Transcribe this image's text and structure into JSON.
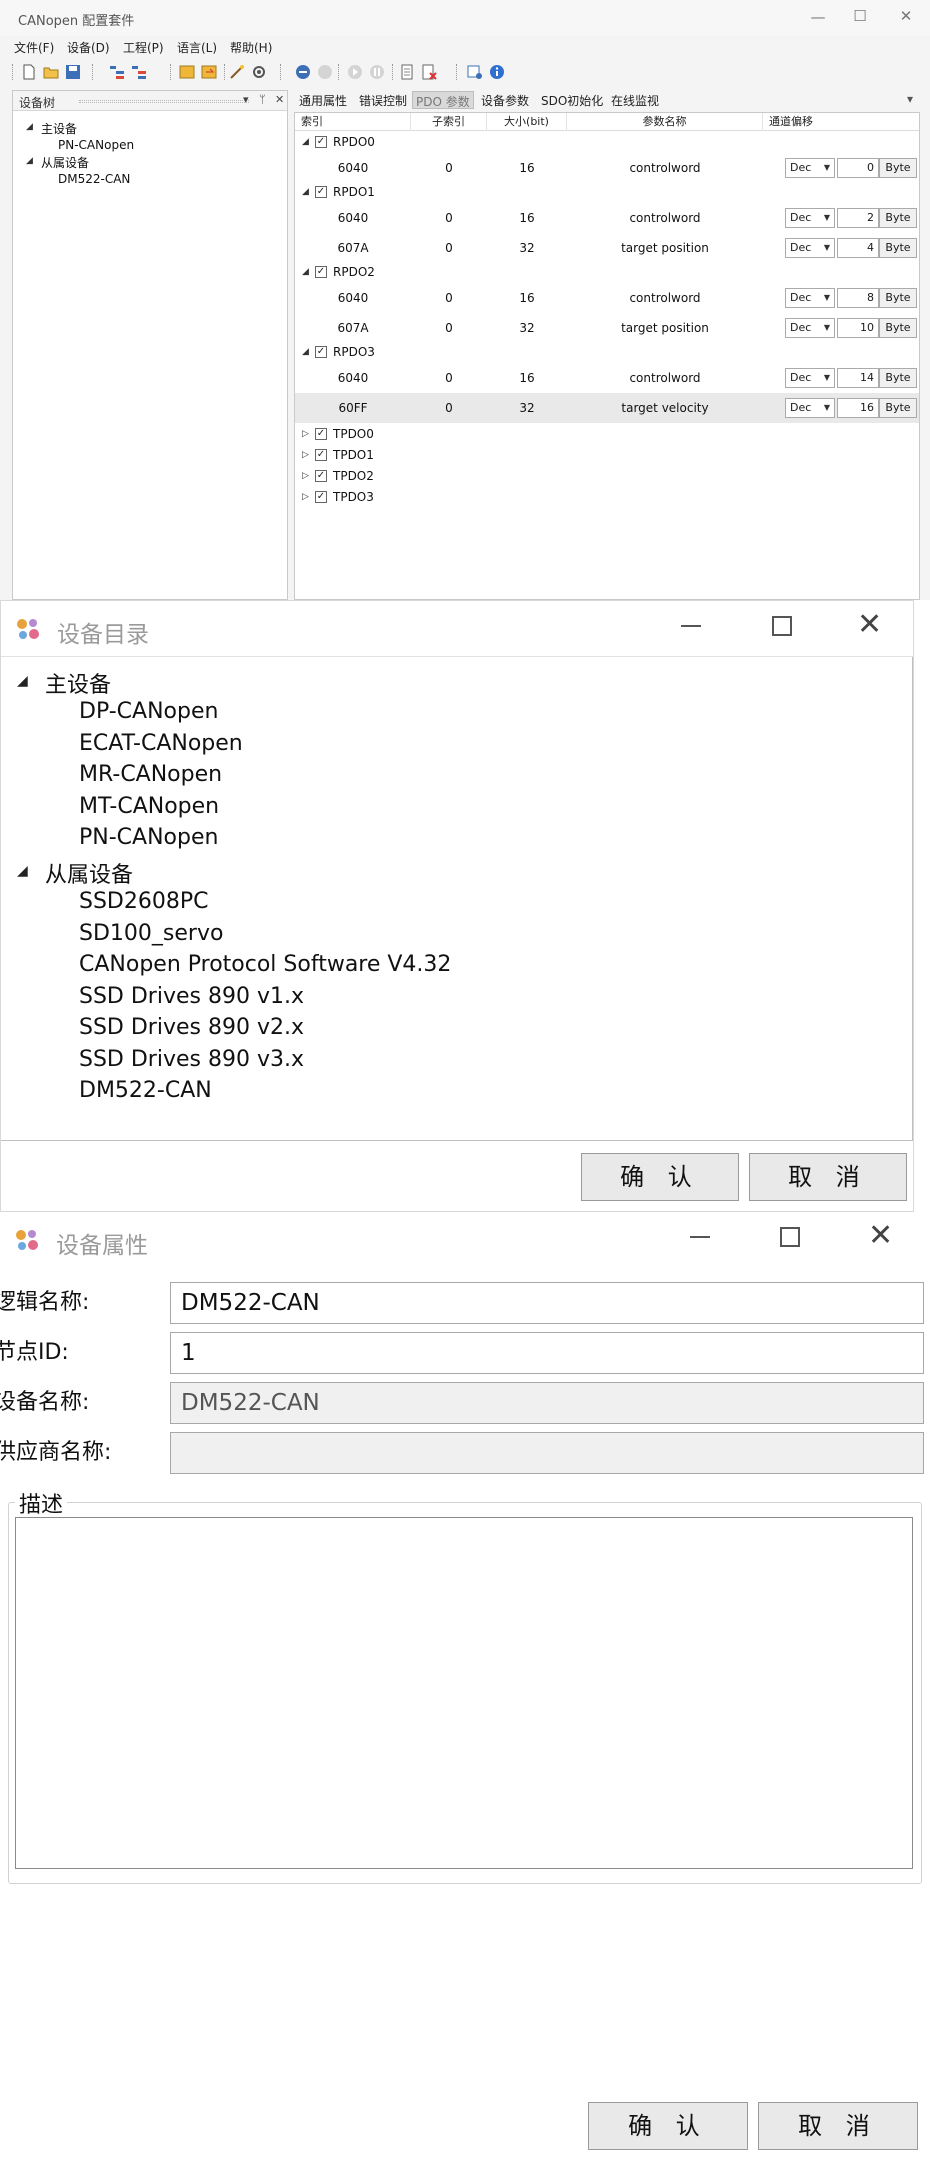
{
  "app": {
    "title": "CANopen 配置套件",
    "menu": [
      "文件(F)",
      "设备(D)",
      "工程(P)",
      "语言(L)",
      "帮助(H)"
    ],
    "tree_panel": {
      "title": "设备树",
      "items": [
        {
          "label": "主设备",
          "level": 0,
          "expanded": true
        },
        {
          "label": "PN-CANopen",
          "level": 1
        },
        {
          "label": "从属设备",
          "level": 0,
          "expanded": true
        },
        {
          "label": "DM522-CAN",
          "level": 1
        }
      ]
    },
    "tabs": [
      "通用属性",
      "错误控制",
      "PDO 参数",
      "设备参数",
      "SDO初始化",
      "在线监视"
    ],
    "active_tab": 2,
    "pdo_table": {
      "columns": [
        "索引",
        "子索引",
        "大小(bit)",
        "参数名称",
        "通道偏移"
      ],
      "rpdo_groups": [
        {
          "name": "RPDO0",
          "rows": [
            {
              "index": "6040",
              "sub": "0",
              "size": "16",
              "param": "controlword",
              "format": "Dec",
              "offset": "0",
              "unit": "Byte"
            }
          ]
        },
        {
          "name": "RPDO1",
          "rows": [
            {
              "index": "6040",
              "sub": "0",
              "size": "16",
              "param": "controlword",
              "format": "Dec",
              "offset": "2",
              "unit": "Byte"
            },
            {
              "index": "607A",
              "sub": "0",
              "size": "32",
              "param": "target position",
              "format": "Dec",
              "offset": "4",
              "unit": "Byte"
            }
          ]
        },
        {
          "name": "RPDO2",
          "rows": [
            {
              "index": "6040",
              "sub": "0",
              "size": "16",
              "param": "controlword",
              "format": "Dec",
              "offset": "8",
              "unit": "Byte"
            },
            {
              "index": "607A",
              "sub": "0",
              "size": "32",
              "param": "target position",
              "format": "Dec",
              "offset": "10",
              "unit": "Byte"
            }
          ]
        },
        {
          "name": "RPDO3",
          "rows": [
            {
              "index": "6040",
              "sub": "0",
              "size": "16",
              "param": "controlword",
              "format": "Dec",
              "offset": "14",
              "unit": "Byte"
            },
            {
              "index": "60FF",
              "sub": "0",
              "size": "32",
              "param": "target velocity",
              "format": "Dec",
              "offset": "16",
              "unit": "Byte",
              "selected": true
            }
          ]
        }
      ],
      "tpdo_groups": [
        "TPDO0",
        "TPDO1",
        "TPDO2",
        "TPDO3"
      ]
    }
  },
  "catalog": {
    "title": "设备目录",
    "groups": [
      {
        "label": "主设备",
        "items": [
          "DP-CANopen",
          "ECAT-CANopen",
          "MR-CANopen",
          "MT-CANopen",
          "PN-CANopen"
        ]
      },
      {
        "label": "从属设备",
        "items": [
          "SSD2608PC",
          "SD100_servo",
          "CANopen Protocol Software V4.32",
          "SSD Drives 890 v1.x",
          "SSD Drives 890 v2.x",
          "SSD Drives 890 v3.x",
          "DM522-CAN"
        ]
      }
    ],
    "ok_label": "确 认",
    "cancel_label": "取 消"
  },
  "props": {
    "title": "设备属性",
    "logic_name_label": "逻辑名称:",
    "logic_name_value": "DM522-CAN",
    "node_id_label": "节点ID:",
    "node_id_value": "1",
    "device_name_label": "设备名称:",
    "device_name_value": "DM522-CAN",
    "vendor_label": "供应商名称:",
    "vendor_value": "",
    "desc_label": "描述",
    "ok_label": "确 认",
    "cancel_label": "取 消"
  }
}
